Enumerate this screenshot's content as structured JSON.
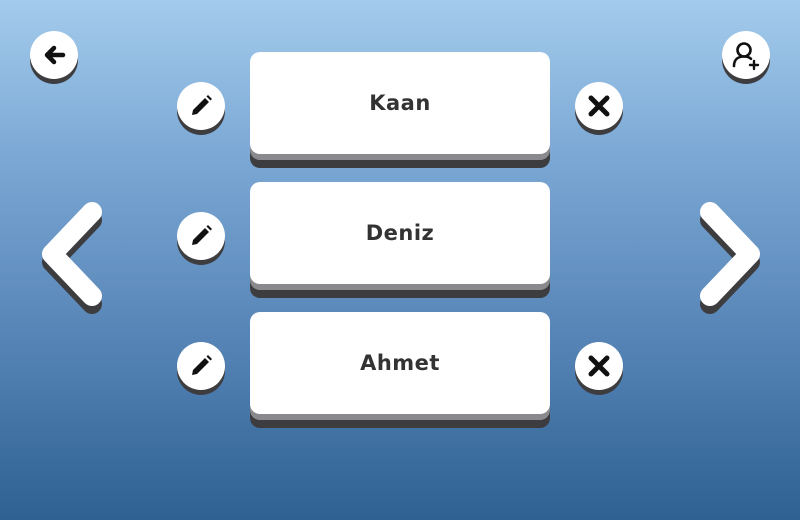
{
  "header": {
    "back_icon": "arrow-left-icon",
    "add_user_icon": "user-add-icon"
  },
  "players": [
    {
      "name": "Kaan",
      "edit_icon": "pencil-icon",
      "delete_icon": "close-icon"
    },
    {
      "name": "Deniz",
      "edit_icon": "pencil-icon"
    },
    {
      "name": "Ahmet",
      "edit_icon": "pencil-icon",
      "delete_icon": "close-icon"
    }
  ],
  "navigation": {
    "prev_icon": "chevron-left-icon",
    "next_icon": "chevron-right-icon"
  },
  "colors": {
    "background_top": "#a3cbec",
    "background_bottom": "#2f6193",
    "card": "#ffffff",
    "card_shadow": "#3d3d40",
    "icon": "#111111",
    "text": "#333333"
  }
}
